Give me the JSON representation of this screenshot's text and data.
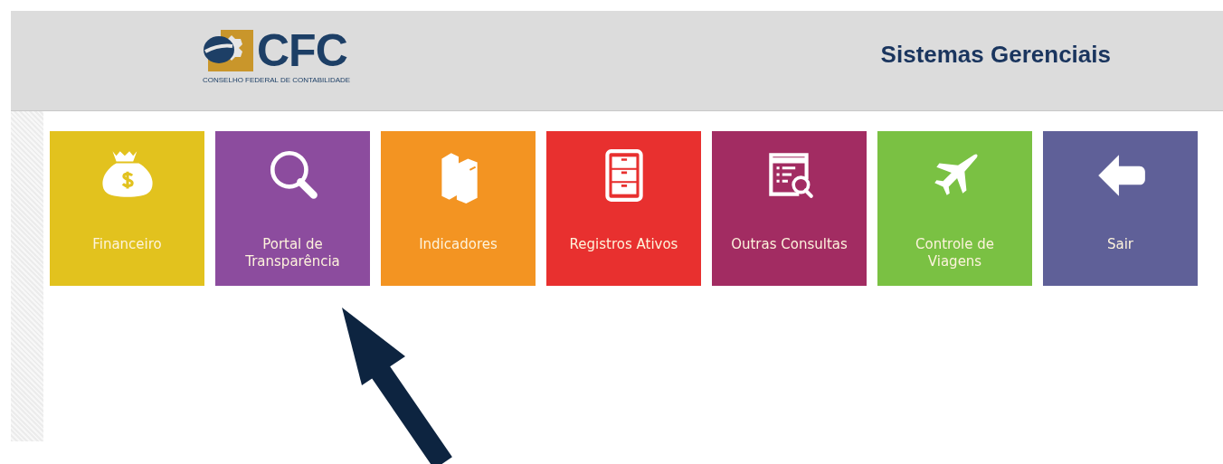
{
  "header": {
    "logo": {
      "mark": "CFC",
      "subtitle": "CONSELHO FEDERAL DE CONTABILIDADE"
    },
    "title": "Sistemas Gerenciais"
  },
  "tiles": [
    {
      "label": "Financeiro",
      "kind": "money",
      "color": "#e2c21e"
    },
    {
      "label": "Portal de Transparência",
      "kind": "search",
      "color": "#8c4c9e"
    },
    {
      "label": "Indicadores",
      "kind": "books",
      "color": "#f39422"
    },
    {
      "label": "Registros Ativos",
      "kind": "cabinet",
      "color": "#e8302f"
    },
    {
      "label": "Outras Consultas",
      "kind": "report",
      "color": "#a22c62"
    },
    {
      "label": "Controle de Viagens",
      "kind": "plane",
      "color": "#7ac143"
    },
    {
      "label": "Sair",
      "kind": "exit",
      "color": "#5f6098"
    }
  ]
}
